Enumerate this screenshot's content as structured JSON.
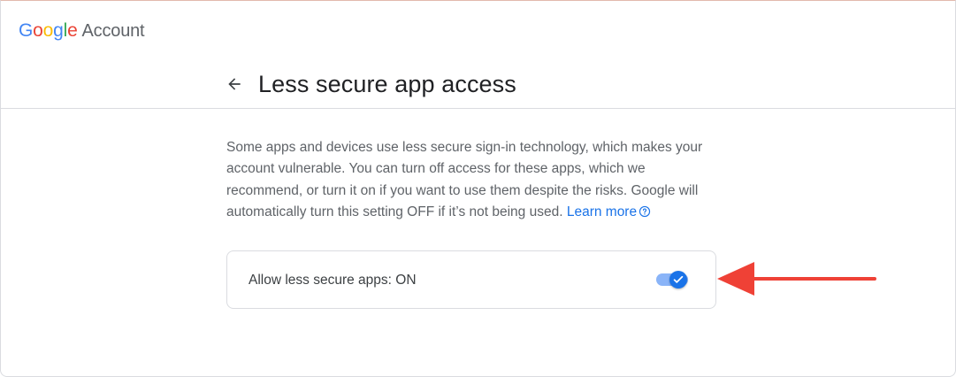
{
  "header": {
    "logo_letters": [
      {
        "ch": "G",
        "color": "#4285F4"
      },
      {
        "ch": "o",
        "color": "#EA4335"
      },
      {
        "ch": "o",
        "color": "#FBBC05"
      },
      {
        "ch": "g",
        "color": "#4285F4"
      },
      {
        "ch": "l",
        "color": "#34A853"
      },
      {
        "ch": "e",
        "color": "#EA4335"
      }
    ],
    "product": "Account"
  },
  "page": {
    "title": "Less secure app access",
    "back_icon": "arrow-back-icon",
    "description": "Some apps and devices use less secure sign-in technology, which makes your account vulnerable. You can turn off access for these apps, which we recommend, or turn it on if you want to use them despite the risks. Google will automatically turn this setting OFF if it’s not being used.",
    "learn_more": "Learn more",
    "help_icon": "help-circle-icon"
  },
  "setting": {
    "label": "Allow less secure apps: ON",
    "toggle_on": true,
    "toggle_icon": "check-icon"
  },
  "colors": {
    "accent": "#1a73e8",
    "track": "#8ab4f8",
    "annotation_arrow": "#ef4136"
  }
}
